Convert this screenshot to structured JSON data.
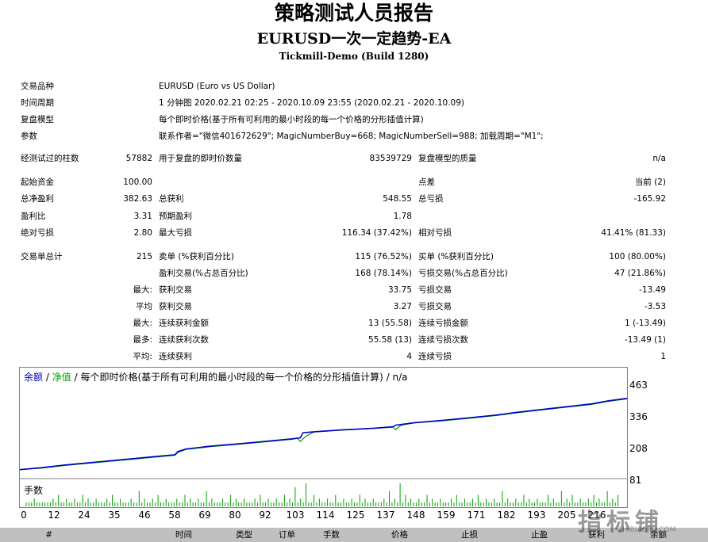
{
  "report": {
    "title": "策略测试人员报告",
    "ea_name": "EURUSD一次一定趋势-EA",
    "server": "Tickmill-Demo (Build 1280)"
  },
  "info": {
    "symbol_label": "交易品种",
    "symbol_value": "EURUSD (Euro vs US Dollar)",
    "period_label": "时间周期",
    "period_value": "1 分钟图 2020.02.21 02:25 - 2020.10.09 23:55 (2020.02.21 - 2020.10.09)",
    "model_label": "复盘模型",
    "model_value": "每个即时价格(基于所有可利用的最小时段的每一个价格的分形插值计算)",
    "params_label": "参数",
    "params_value": "联系作者=\"微信401672629\"; MagicNumberBuy=668; MagicNumberSell=988; 加载周期=\"M1\";"
  },
  "bars": {
    "bars_label": "经测试过的柱数",
    "bars_value": "57882",
    "ticks_label": "用于复盘的即时价数量",
    "ticks_value": "83539729",
    "quality_label": "复盘模型的质量",
    "quality_value": "n/a"
  },
  "money": {
    "deposit_label": "起始资金",
    "deposit_value": "100.00",
    "spread_label": "点差",
    "spread_value": "当前 (2)",
    "net_label": "总净盈利",
    "net_value": "382.63",
    "gross_profit_label": "总获利",
    "gross_profit_value": "548.55",
    "gross_loss_label": "总亏损",
    "gross_loss_value": "-165.92",
    "pf_label": "盈利比",
    "pf_value": "3.31",
    "payoff_label": "预期盈利",
    "payoff_value": "1.78",
    "abs_dd_label": "绝对亏损",
    "abs_dd_value": "2.80",
    "max_dd_label": "最大亏损",
    "max_dd_value": "116.34 (37.42%)",
    "rel_dd_label": "相对亏损",
    "rel_dd_value": "41.41% (81.33)"
  },
  "trades": {
    "total_label": "交易单总计",
    "total_value": "215",
    "short_label": "卖单 (%获利百分比)",
    "short_value": "115 (76.52%)",
    "long_label": "买单 (%获利百分比)",
    "long_value": "100 (80.00%)",
    "profit_trades_label": "盈利交易(%占总百分比)",
    "profit_trades_value": "168 (78.14%)",
    "loss_trades_label": "亏损交易(%占总百分比)",
    "loss_trades_value": "47 (21.86%)",
    "largest_label": "最大:",
    "largest_profit_label": "获利交易",
    "largest_profit_value": "33.75",
    "largest_loss_label": "亏损交易",
    "largest_loss_value": "-13.49",
    "average_label": "平均",
    "average_profit_label": "获利交易",
    "average_profit_value": "3.27",
    "average_loss_label": "亏损交易",
    "average_loss_value": "-3.53",
    "max_label": "最大:",
    "max_cons_win_label": "连续获利金额",
    "max_cons_win_value": "13 (55.58)",
    "max_cons_loss_label": "连续亏损金额",
    "max_cons_loss_value": "1 (-13.49)",
    "most_label": "最多:",
    "most_cons_win_label": "连续获利次数",
    "most_cons_win_value": "55.58 (13)",
    "most_cons_loss_label": "连续亏损次数",
    "most_cons_loss_value": "-13.49 (1)",
    "avg_cons_label": "平均:",
    "avg_cons_win_label": "连续获利",
    "avg_cons_win_value": "4",
    "avg_cons_loss_label": "连续亏损",
    "avg_cons_loss_value": "1"
  },
  "chart_header": {
    "balance": "余额",
    "sep1": "/",
    "equity": "净值",
    "sep2": "/",
    "rest": "每个即时价格(基于所有可利用的最小时段的每一个价格的分形插值计算) / n/a",
    "balance_color": "#0000c8",
    "equity_color": "#00a000"
  },
  "lots_label": "手数",
  "chart_data": {
    "type": "line",
    "title": "",
    "xlabel": "",
    "ylabel": "",
    "x_ticks": [
      "0",
      "12",
      "24",
      "35",
      "46",
      "58",
      "69",
      "80",
      "92",
      "103",
      "114",
      "125",
      "137",
      "148",
      "159",
      "171",
      "182",
      "193",
      "205",
      "216"
    ],
    "y_ticks": [
      "463",
      "336",
      "208",
      "81"
    ],
    "xlim": [
      0,
      223
    ],
    "ylim": [
      71,
      497
    ],
    "series": [
      {
        "name": "余额",
        "color": "#0000c8",
        "points": [
          [
            0,
            100
          ],
          [
            8,
            108
          ],
          [
            16,
            118
          ],
          [
            22,
            124
          ],
          [
            30,
            132
          ],
          [
            40,
            142
          ],
          [
            50,
            152
          ],
          [
            57,
            159
          ],
          [
            58,
            172
          ],
          [
            61,
            182
          ],
          [
            70,
            193
          ],
          [
            80,
            202
          ],
          [
            90,
            212
          ],
          [
            100,
            222
          ],
          [
            103,
            226
          ],
          [
            104,
            246
          ],
          [
            108,
            250
          ],
          [
            118,
            257
          ],
          [
            130,
            264
          ],
          [
            137,
            270
          ],
          [
            138,
            276
          ],
          [
            145,
            286
          ],
          [
            155,
            295
          ],
          [
            165,
            305
          ],
          [
            175,
            316
          ],
          [
            182,
            326
          ],
          [
            190,
            336
          ],
          [
            200,
            348
          ],
          [
            210,
            360
          ],
          [
            216,
            372
          ],
          [
            223,
            382
          ]
        ]
      },
      {
        "name": "净值",
        "color": "#00a000",
        "points": [
          [
            0,
            100
          ],
          [
            8,
            106
          ],
          [
            16,
            116
          ],
          [
            22,
            122
          ],
          [
            30,
            130
          ],
          [
            40,
            140
          ],
          [
            50,
            150
          ],
          [
            57,
            157
          ],
          [
            58,
            168
          ],
          [
            61,
            180
          ],
          [
            70,
            191
          ],
          [
            80,
            200
          ],
          [
            90,
            210
          ],
          [
            100,
            220
          ],
          [
            102,
            224
          ],
          [
            103,
            211
          ],
          [
            105,
            232
          ],
          [
            108,
            249
          ],
          [
            118,
            256
          ],
          [
            130,
            263
          ],
          [
            137,
            268
          ],
          [
            138,
            258
          ],
          [
            140,
            276
          ],
          [
            145,
            285
          ],
          [
            155,
            293
          ],
          [
            165,
            303
          ],
          [
            175,
            314
          ],
          [
            182,
            324
          ],
          [
            190,
            334
          ],
          [
            200,
            346
          ],
          [
            210,
            358
          ],
          [
            216,
            370
          ],
          [
            223,
            380
          ]
        ]
      }
    ],
    "lots": [
      1,
      1,
      1,
      2,
      1,
      1,
      1,
      1,
      1,
      1,
      2,
      1,
      3,
      1,
      1,
      2,
      1,
      1,
      2,
      1,
      1,
      3,
      1,
      2,
      1,
      1,
      2,
      1,
      1,
      1,
      2,
      1,
      3,
      1,
      1,
      2,
      1,
      1,
      1,
      2,
      1,
      1,
      4,
      1,
      2,
      1,
      1,
      2,
      1,
      3,
      1,
      1,
      2,
      1,
      1,
      1,
      2,
      1,
      1,
      3,
      1,
      2,
      1,
      1,
      2,
      1,
      1,
      4,
      1,
      2,
      1,
      1,
      1,
      2,
      1,
      1,
      3,
      1,
      2,
      1,
      1,
      2,
      1,
      1,
      1,
      2,
      1,
      3,
      1,
      1,
      2,
      1,
      1,
      2,
      1,
      1,
      3,
      1,
      2,
      1,
      5,
      1,
      2,
      1,
      6,
      1,
      1,
      3,
      1,
      2,
      1,
      1,
      2,
      1,
      1,
      3,
      1,
      1,
      2,
      1,
      1,
      2,
      1,
      1,
      3,
      1,
      2,
      1,
      1,
      2,
      1,
      1,
      1,
      2,
      1,
      4,
      1,
      2,
      1,
      6,
      1,
      3,
      1,
      2,
      1,
      1,
      2,
      1,
      1,
      3,
      1,
      2,
      1,
      1,
      2,
      1,
      1,
      1,
      2,
      1,
      3,
      1,
      1,
      2,
      1,
      1,
      2,
      1,
      3,
      1,
      1,
      2,
      1,
      1,
      2,
      1,
      1,
      4,
      1,
      2,
      1,
      1,
      2,
      1,
      1,
      3,
      1,
      2,
      1,
      1,
      2,
      1,
      1,
      1,
      3,
      1,
      2,
      1,
      1,
      4,
      1,
      2,
      1,
      3,
      1,
      1,
      2,
      1,
      1,
      2,
      1,
      3,
      1,
      2,
      1,
      1,
      4,
      1,
      2,
      1,
      3
    ],
    "lots_max": 6
  },
  "table_header": [
    "#",
    "时间",
    "类型",
    "订单",
    "手数",
    "价格",
    "止损",
    "止盈",
    "获利",
    "余额"
  ],
  "watermark": {
    "text": "指标铺",
    "sub": "ZHIBIAOPU.COM"
  }
}
